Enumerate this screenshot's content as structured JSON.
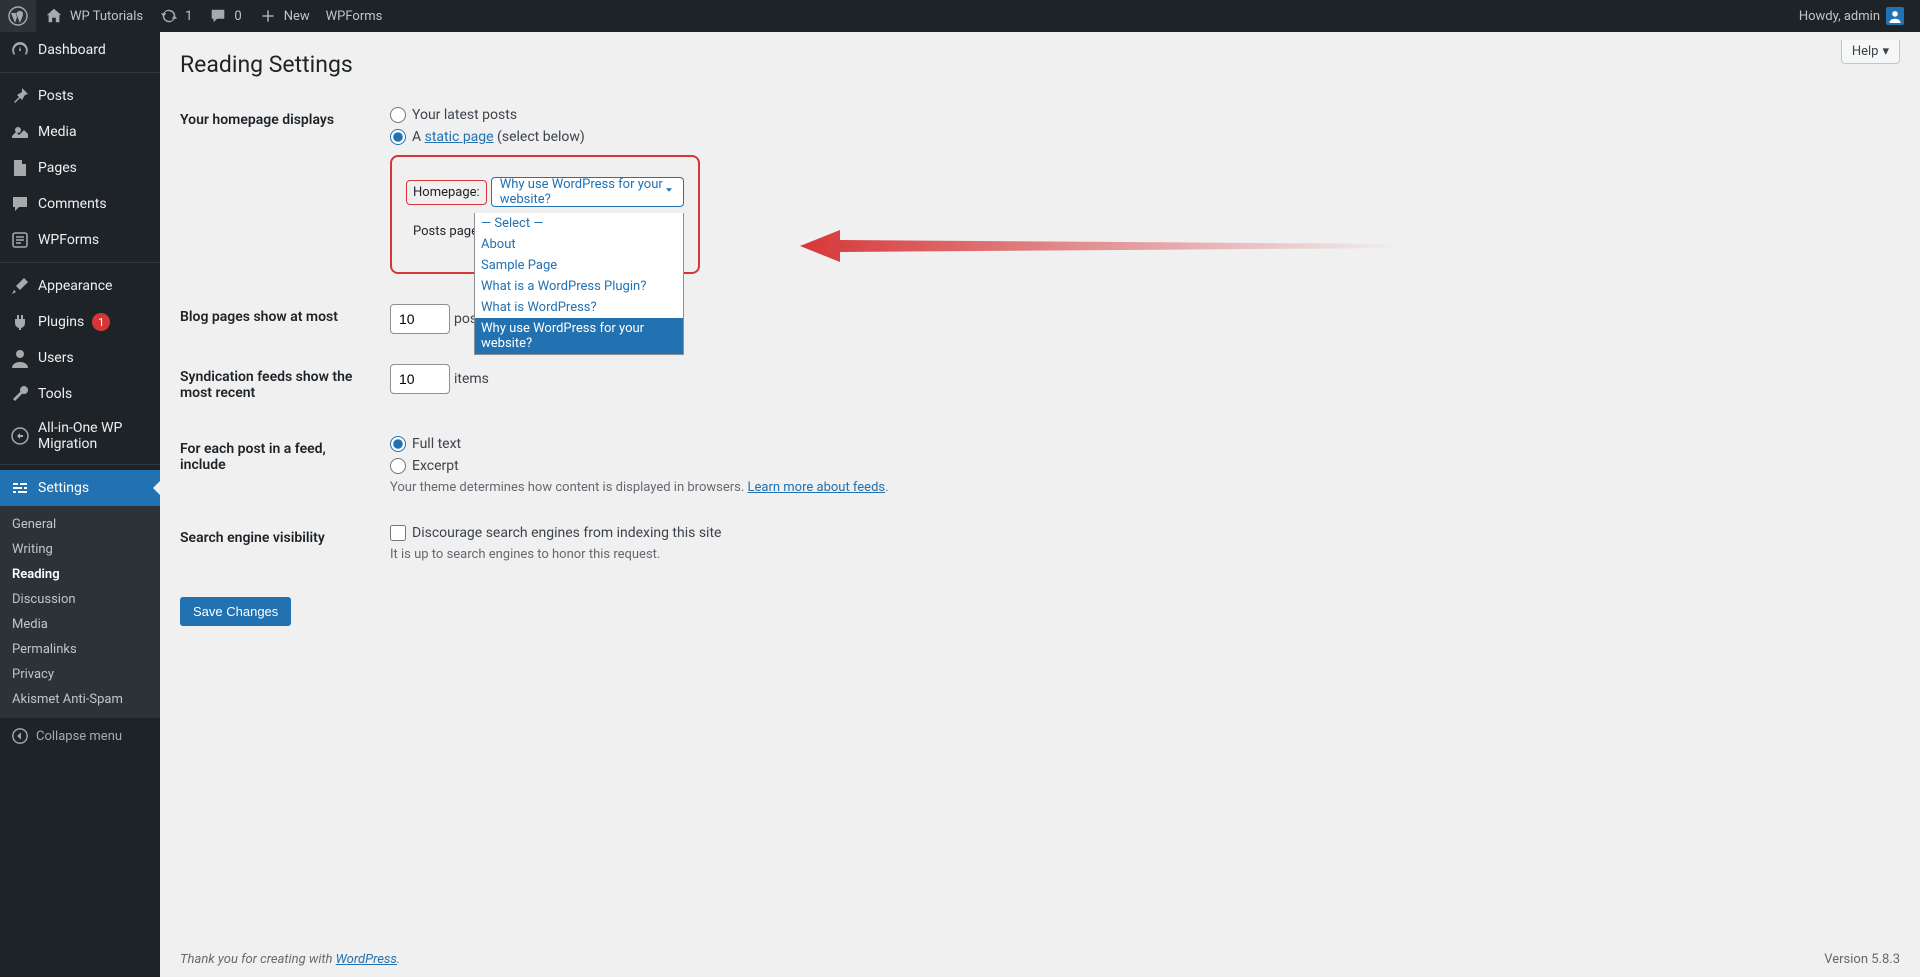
{
  "adminbar": {
    "site_name": "WP Tutorials",
    "updates": "1",
    "comments": "0",
    "new": "New",
    "wpforms": "WPForms",
    "howdy": "Howdy, admin"
  },
  "sidebar": {
    "items": [
      {
        "icon": "dashboard",
        "label": "Dashboard"
      },
      {
        "icon": "pin",
        "label": "Posts"
      },
      {
        "icon": "media",
        "label": "Media"
      },
      {
        "icon": "page",
        "label": "Pages"
      },
      {
        "icon": "comment",
        "label": "Comments"
      },
      {
        "icon": "wpforms",
        "label": "WPForms"
      },
      {
        "icon": "brush",
        "label": "Appearance"
      },
      {
        "icon": "plug",
        "label": "Plugins",
        "badge": "1"
      },
      {
        "icon": "user",
        "label": "Users"
      },
      {
        "icon": "wrench",
        "label": "Tools"
      },
      {
        "icon": "migrate",
        "label": "All-in-One WP Migration"
      },
      {
        "icon": "sliders",
        "label": "Settings",
        "current": true
      }
    ],
    "submenu": [
      "General",
      "Writing",
      "Reading",
      "Discussion",
      "Media",
      "Permalinks",
      "Privacy",
      "Akismet Anti-Spam"
    ],
    "submenu_current": "Reading",
    "collapse": "Collapse menu"
  },
  "page": {
    "help": "Help",
    "title": "Reading Settings",
    "rows": {
      "homepage_displays": "Your homepage displays",
      "latest_posts": "Your latest posts",
      "static_page_prefix": "A ",
      "static_page_link": "static page",
      "static_page_suffix": " (select below)",
      "homepage_label": "Homepage:",
      "posts_page_label": "Posts page:",
      "blog_pages": "Blog pages show at most",
      "blog_pages_value": "10",
      "blog_pages_unit": "posts",
      "syndication": "Syndication feeds show the most recent",
      "syndication_value": "10",
      "syndication_unit": "items",
      "feed_include": "For each post in a feed, include",
      "full_text": "Full text",
      "excerpt": "Excerpt",
      "feed_desc_prefix": "Your theme determines how content is displayed in browsers. ",
      "feed_desc_link": "Learn more about feeds",
      "search_vis": "Search engine visibility",
      "discourage": "Discourage search engines from indexing this site",
      "honor": "It is up to search engines to honor this request.",
      "save": "Save Changes"
    },
    "select": {
      "selected": "Why use WordPress for your website?",
      "options": [
        "— Select —",
        "About",
        "Sample Page",
        "What is a WordPress Plugin?",
        "What is WordPress?",
        "Why use WordPress for your website?"
      ]
    }
  },
  "footer": {
    "thank_prefix": "Thank you for creating with ",
    "wp": "WordPress",
    "version": "Version 5.8.3"
  }
}
